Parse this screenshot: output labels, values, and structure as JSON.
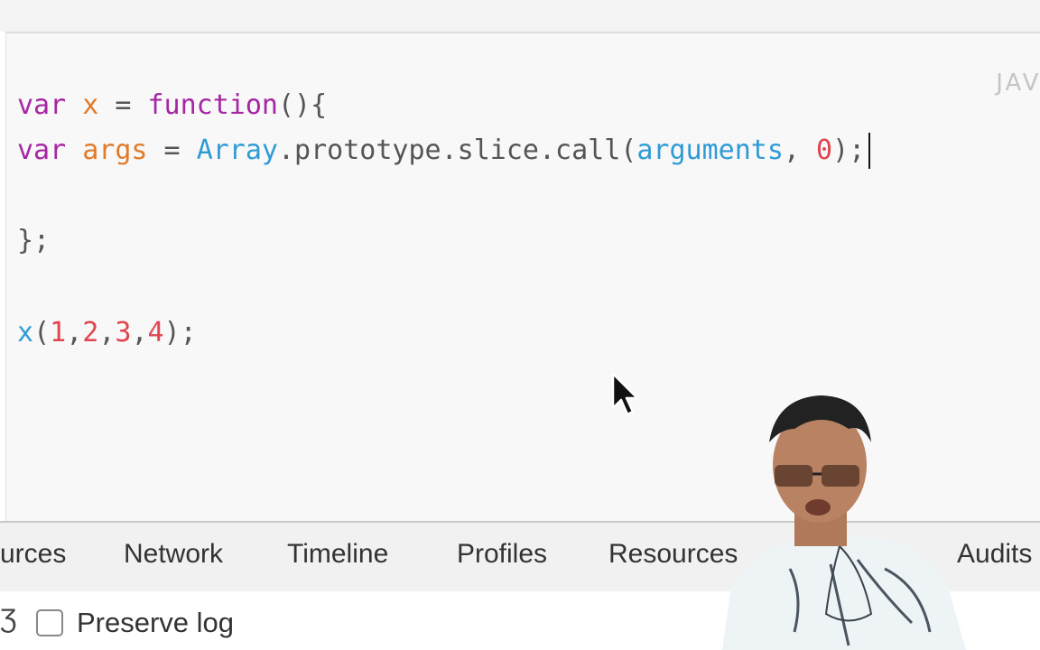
{
  "editor": {
    "language_label": "JAVAS",
    "lines": {
      "l1": {
        "kw": "var",
        "name": "x",
        "op": " = ",
        "fn": "function",
        "rest": "(){"
      },
      "l2": {
        "kw": "var",
        "name": "args",
        "op": " = ",
        "obj": "Array",
        "chain": ".prototype.slice.call(",
        "arg": "arguments",
        "sep": ", ",
        "num": "0",
        "end": ");"
      },
      "l3": {
        "text": "};"
      },
      "l4": {
        "fn": "x",
        "open": "(",
        "n1": "1",
        "n2": "2",
        "n3": "3",
        "n4": "4",
        "comma": ",",
        "close": ");"
      }
    }
  },
  "devtools": {
    "tabs": [
      "urces",
      "Network",
      "Timeline",
      "Profiles",
      "Resources",
      "Audits"
    ],
    "filter_glyph": "Ʒ",
    "preserve_log_label": "Preserve log",
    "preserve_log_checked": false
  },
  "colors": {
    "keyword": "#a626a4",
    "variable": "#e07b2a",
    "builtin": "#2f9bd6",
    "number": "#e0454f"
  },
  "icons": {
    "pointer": "mouse-pointer-icon",
    "presenter": "presenter-video-overlay"
  }
}
